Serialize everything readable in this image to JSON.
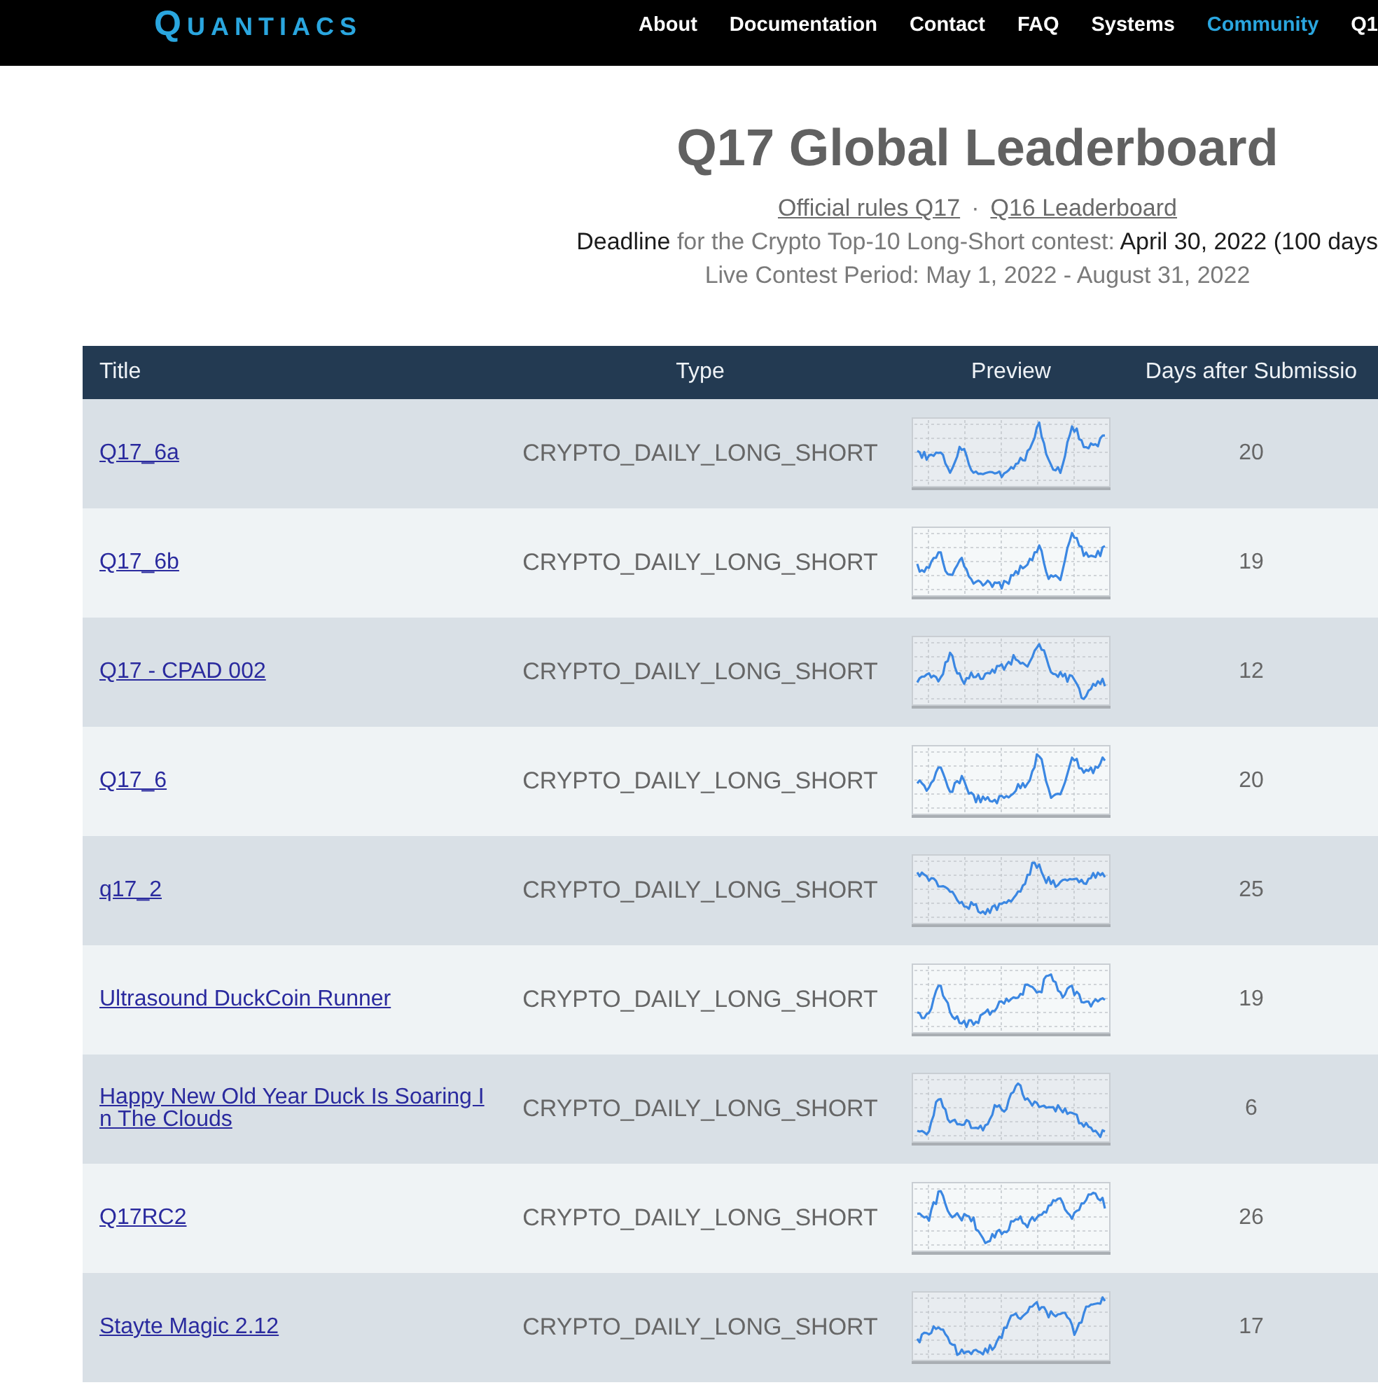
{
  "header": {
    "logo": "QUANTIACS",
    "nav": [
      {
        "label": "About",
        "selected": false
      },
      {
        "label": "Documentation",
        "selected": false
      },
      {
        "label": "Contact",
        "selected": false
      },
      {
        "label": "FAQ",
        "selected": false
      },
      {
        "label": "Systems",
        "selected": false
      },
      {
        "label": "Community",
        "selected": true
      },
      {
        "label": "Q1",
        "selected": false
      }
    ]
  },
  "contest": {
    "title": "Q17 Global Leaderboard",
    "links": [
      "Official rules Q17",
      "Q16 Leaderboard"
    ],
    "separator": "·",
    "deadline": "**Deadline** for the Crypto Top-10 Long-Short contest: **April 30, 2022 (100 days**",
    "period": "Live Contest Period: May 1, 2022 - August 31, 2022"
  },
  "table": {
    "columns": [
      "Title",
      "Type",
      "Preview",
      "Days after Submissio"
    ],
    "rows": [
      {
        "title": "Q17_6a",
        "type": "CRYPTO_DAILY_LONG_SHORT",
        "days": "20"
      },
      {
        "title": "Q17_6b",
        "type": "CRYPTO_DAILY_LONG_SHORT",
        "days": "19"
      },
      {
        "title": "Q17 - CPAD 002",
        "type": "CRYPTO_DAILY_LONG_SHORT",
        "days": "12"
      },
      {
        "title": "Q17_6",
        "type": "CRYPTO_DAILY_LONG_SHORT",
        "days": "20"
      },
      {
        "title": "q17_2",
        "type": "CRYPTO_DAILY_LONG_SHORT",
        "days": "25"
      },
      {
        "title": "Ultrasound DuckCoin Runner",
        "type": "CRYPTO_DAILY_LONG_SHORT",
        "days": "19"
      },
      {
        "title": "Happy New Old Year Duck Is Soaring In The Clouds",
        "type": "CRYPTO_DAILY_LONG_SHORT",
        "days": "6"
      },
      {
        "title": "Q17RC2",
        "type": "CRYPTO_DAILY_LONG_SHORT",
        "days": "26"
      },
      {
        "title": "Stayte Magic 2.12",
        "type": "CRYPTO_DAILY_LONG_SHORT",
        "days": "17"
      }
    ]
  }
}
